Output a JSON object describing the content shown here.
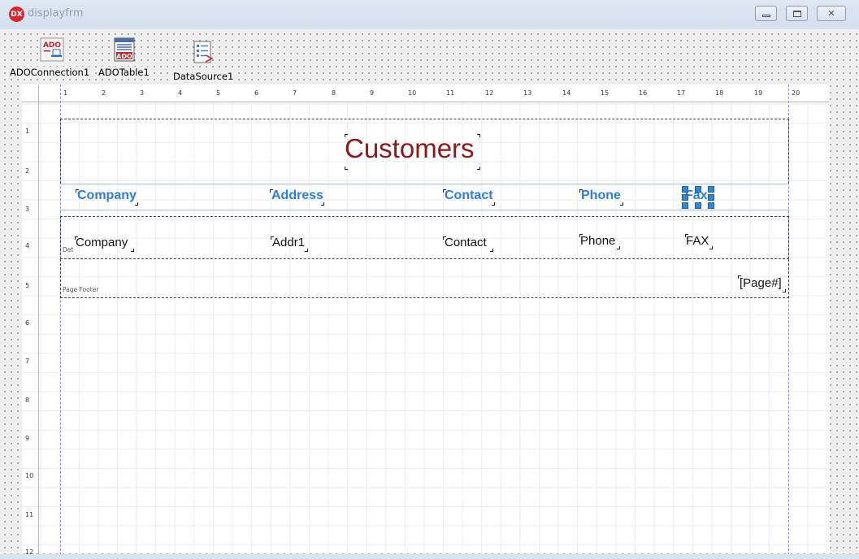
{
  "window": {
    "title": "displayfrm",
    "app_icon": "DX",
    "colors": {
      "title_text": "#8fa0b4",
      "app_icon_bg": "#d8282e"
    }
  },
  "components": [
    {
      "name": "ADOConnection1",
      "icon": "ado-connection-icon"
    },
    {
      "name": "ADOTable1",
      "icon": "ado-table-icon"
    },
    {
      "name": "DataSource1",
      "icon": "datasource-icon"
    }
  ],
  "ruler": {
    "top": [
      "1",
      "2",
      "3",
      "4",
      "5",
      "6",
      "7",
      "8",
      "9",
      "10",
      "11",
      "12",
      "13",
      "14",
      "15",
      "16",
      "17",
      "18",
      "19",
      "20"
    ],
    "left": [
      "1",
      "2",
      "3",
      "4",
      "5",
      "6",
      "7",
      "8",
      "9",
      "10",
      "11",
      "12"
    ]
  },
  "report": {
    "title": {
      "text": "Customers",
      "color": "#8b1a1a"
    },
    "column_header": {
      "color": "#2b7de0",
      "labels": [
        "Company",
        "Address",
        "Contact",
        "Phone",
        "Fax"
      ]
    },
    "detail": {
      "band_tag": "Det",
      "fields": [
        "Company",
        "Addr1",
        "Contact",
        "Phone",
        "FAX"
      ]
    },
    "page_footer": {
      "band_tag": "Page Footer",
      "page_number": "[Page#]"
    }
  }
}
